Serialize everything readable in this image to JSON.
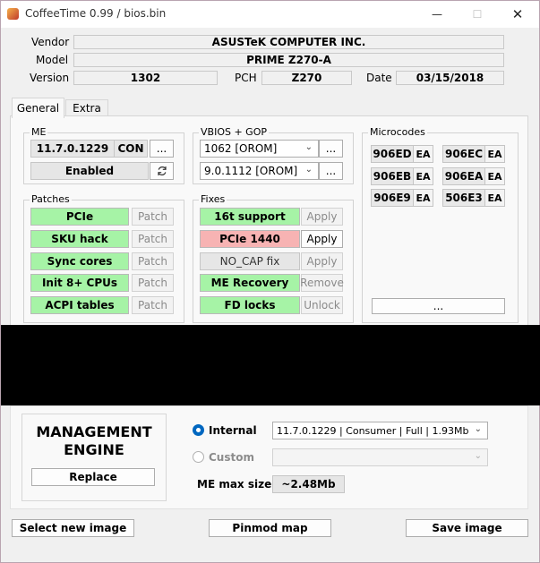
{
  "window": {
    "title": "CoffeeTime 0.99  /  bios.bin",
    "buttons": {
      "minimize": "—",
      "maximize": "☐",
      "close": "✕"
    }
  },
  "info": {
    "vendor_label": "Vendor",
    "vendor": "ASUSTeK COMPUTER INC.",
    "model_label": "Model",
    "model": "PRIME Z270-A",
    "version_label": "Version",
    "version": "1302",
    "pch_label": "PCH",
    "pch": "Z270",
    "date_label": "Date",
    "date": "03/15/2018"
  },
  "tabs": [
    "General",
    "Extra"
  ],
  "me": {
    "title": "ME",
    "version": "11.7.0.1229",
    "con": "CON",
    "more": "...",
    "state": "Enabled",
    "refresh_icon": "refresh-icon"
  },
  "vbios": {
    "title": "VBIOS + GOP",
    "vbios_value": "1062 [OROM]",
    "gop_value": "9.0.1112 [OROM]",
    "more": "..."
  },
  "microcodes": {
    "title": "Microcodes",
    "items": [
      {
        "id": "906ED",
        "tag": "EA"
      },
      {
        "id": "906EC",
        "tag": "EA"
      },
      {
        "id": "906EB",
        "tag": "EA"
      },
      {
        "id": "906EA",
        "tag": "EA"
      },
      {
        "id": "906E9",
        "tag": "EA"
      },
      {
        "id": "506E3",
        "tag": "EA"
      }
    ],
    "more": "..."
  },
  "patches": {
    "title": "Patches",
    "items": [
      {
        "label": "PCIe",
        "action": "Patch"
      },
      {
        "label": "SKU hack",
        "action": "Patch"
      },
      {
        "label": "Sync cores",
        "action": "Patch"
      },
      {
        "label": "Init 8+ CPUs",
        "action": "Patch"
      },
      {
        "label": "ACPI tables",
        "action": "Patch"
      }
    ]
  },
  "fixes": {
    "title": "Fixes",
    "items": [
      {
        "label": "16t support",
        "action": "Apply"
      },
      {
        "label": "PCIe 1440",
        "action": "Apply"
      },
      {
        "label": "NO_CAP fix",
        "action": "Apply"
      },
      {
        "label": "ME Recovery",
        "action": "Remove"
      },
      {
        "label": "FD locks",
        "action": "Unlock"
      }
    ]
  },
  "engine": {
    "heading_line1": "MANAGEMENT",
    "heading_line2": "ENGINE",
    "replace": "Replace",
    "internal_label": "Internal",
    "internal_value": "11.7.0.1229 | Consumer | Full | 1.93Mb",
    "custom_label": "Custom",
    "custom_value": "",
    "max_size_label": "ME max size",
    "max_size_value": "~2.48Mb"
  },
  "footer": {
    "select_image": "Select new image",
    "pinmod_map": "Pinmod map",
    "save_image": "Save image"
  },
  "colors": {
    "enabled_green": "#a6f3a6",
    "warning_red": "#f7b3b3",
    "radio_blue": "#0067c0"
  }
}
